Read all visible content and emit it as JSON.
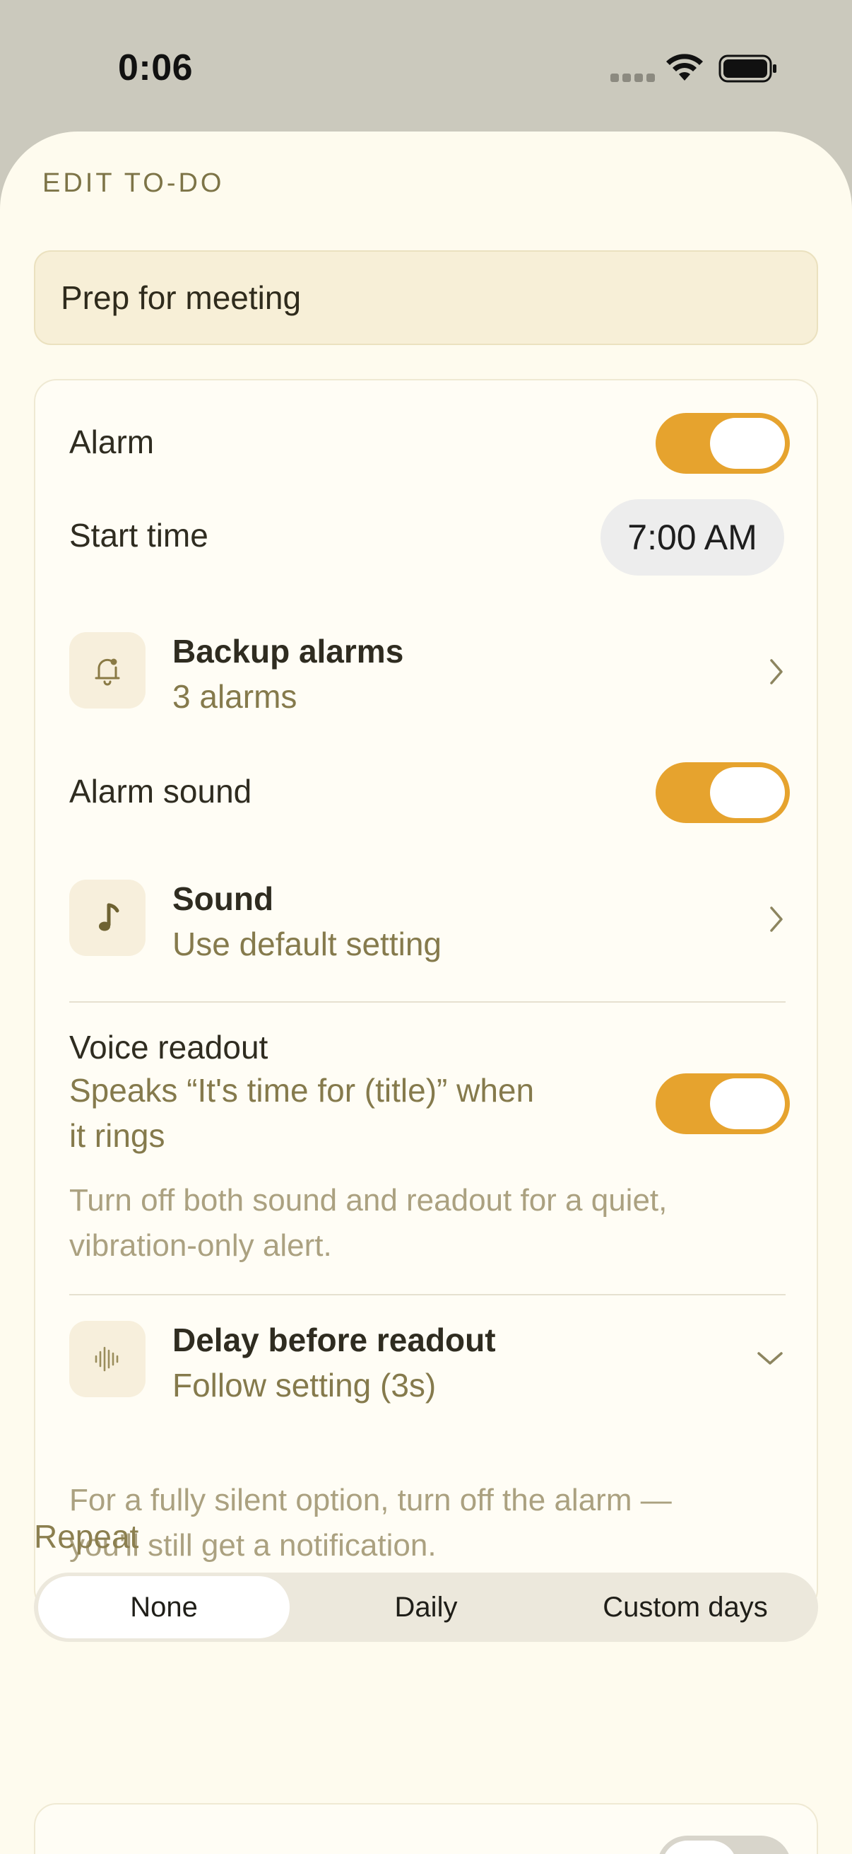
{
  "status_bar": {
    "time": "0:06"
  },
  "sheet": {
    "title": "EDIT TO-DO",
    "todo_title": "Prep for meeting"
  },
  "alarm": {
    "label": "Alarm",
    "enabled": true,
    "start_time_label": "Start time",
    "start_time_value": "7:00 AM"
  },
  "backup_alarms": {
    "title": "Backup alarms",
    "subtitle": "3 alarms",
    "icon": "bell-icon"
  },
  "alarm_sound": {
    "label": "Alarm sound",
    "enabled": true
  },
  "sound": {
    "title": "Sound",
    "subtitle": "Use default setting",
    "icon": "music-note-icon"
  },
  "voice_readout": {
    "label": "Voice readout",
    "description_line1": "Speaks “It's time for (title)” when",
    "description_line2": "it rings",
    "enabled": true,
    "hint_line1": "Turn off both sound and readout for a quiet,",
    "hint_line2": "vibration-only alert."
  },
  "delay": {
    "title": "Delay before readout",
    "subtitle": "Follow setting (3s)",
    "icon": "waveform-icon"
  },
  "silent_hint": {
    "line1": "For a fully silent option, turn off the alarm —",
    "line2": "you'll still get a notification."
  },
  "repeat": {
    "label": "Repeat",
    "options": [
      "None",
      "Daily",
      "Custom days"
    ],
    "selected": "None"
  },
  "colors": {
    "accent": "#e6a32e",
    "sheet_background": "#fefbee",
    "muted_text": "#857a4c"
  }
}
